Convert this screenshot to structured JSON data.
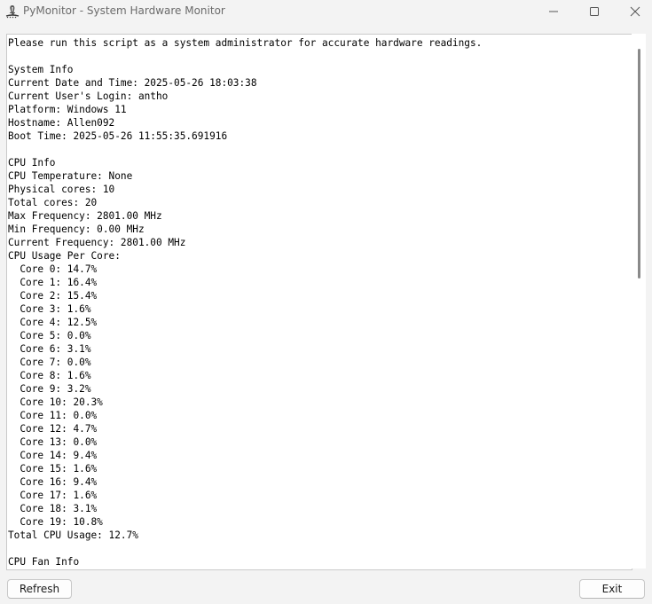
{
  "window": {
    "title": "PyMonitor - System Hardware Monitor",
    "icon": "python-feather-icon"
  },
  "controls": {
    "minimize_icon": "minimize-icon",
    "maximize_icon": "maximize-icon",
    "close_icon": "close-icon"
  },
  "output": {
    "lines": [
      "Please run this script as a system administrator for accurate hardware readings.",
      "",
      "System Info",
      "Current Date and Time: 2025-05-26 18:03:38",
      "Current User's Login: antho",
      "Platform: Windows 11",
      "Hostname: Allen092",
      "Boot Time: 2025-05-26 11:55:35.691916",
      "",
      "CPU Info",
      "CPU Temperature: None",
      "Physical cores: 10",
      "Total cores: 20",
      "Max Frequency: 2801.00 MHz",
      "Min Frequency: 0.00 MHz",
      "Current Frequency: 2801.00 MHz",
      "CPU Usage Per Core:",
      "  Core 0: 14.7%",
      "  Core 1: 16.4%",
      "  Core 2: 15.4%",
      "  Core 3: 1.6%",
      "  Core 4: 12.5%",
      "  Core 5: 0.0%",
      "  Core 6: 3.1%",
      "  Core 7: 0.0%",
      "  Core 8: 1.6%",
      "  Core 9: 3.2%",
      "  Core 10: 20.3%",
      "  Core 11: 0.0%",
      "  Core 12: 4.7%",
      "  Core 13: 0.0%",
      "  Core 14: 9.4%",
      "  Core 15: 1.6%",
      "  Core 16: 9.4%",
      "  Core 17: 1.6%",
      "  Core 18: 3.1%",
      "  Core 19: 10.8%",
      "Total CPU Usage: 12.7%",
      "",
      "CPU Fan Info"
    ]
  },
  "buttons": {
    "refresh_label": "Refresh",
    "exit_label": "Exit"
  }
}
